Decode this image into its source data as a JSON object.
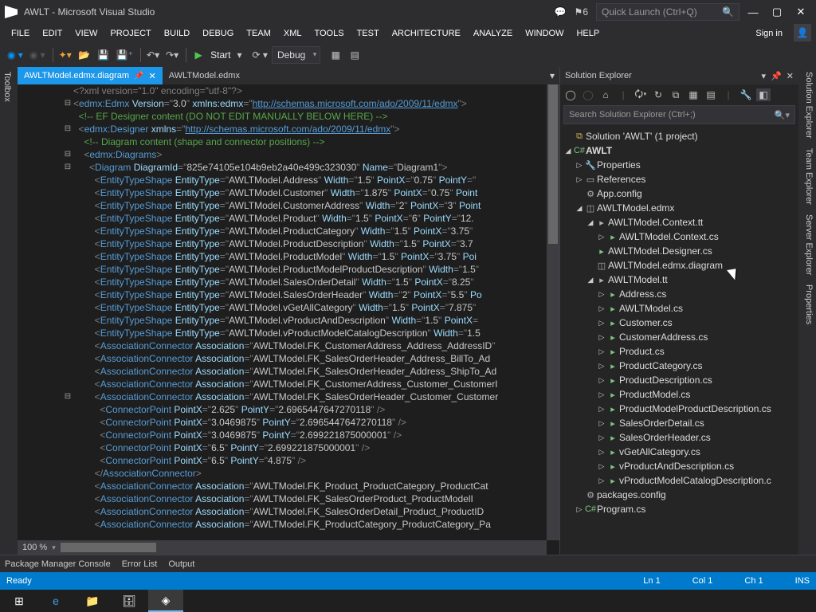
{
  "titlebar": {
    "title": "AWLT - Microsoft Visual Studio",
    "notifications": "6",
    "quicklaunch_placeholder": "Quick Launch (Ctrl+Q)"
  },
  "menu": [
    "FILE",
    "EDIT",
    "VIEW",
    "PROJECT",
    "BUILD",
    "DEBUG",
    "TEAM",
    "XML",
    "TOOLS",
    "TEST",
    "ARCHITECTURE",
    "ANALYZE",
    "WINDOW",
    "HELP"
  ],
  "signin": "Sign in",
  "toolbar": {
    "start": "Start",
    "config": "Debug"
  },
  "left_tool": "Toolbox",
  "tabs": [
    {
      "label": "AWLTModel.edmx.diagram",
      "active": true,
      "pinned": true
    },
    {
      "label": "AWLTModel.edmx",
      "active": false,
      "pinned": false
    }
  ],
  "code_lines": [
    {
      "fold": "",
      "t": "<?xml version=\"1.0\" encoding=\"utf-8\"?>",
      "kind": "pi"
    },
    {
      "fold": "⊟",
      "t": "<edmx:Edmx Version=\"3.0\" xmlns:edmx=\"http://schemas.microsoft.com/ado/2009/11/edmx\">",
      "kind": "el"
    },
    {
      "fold": "",
      "t": "  <!-- EF Designer content (DO NOT EDIT MANUALLY BELOW HERE) -->",
      "kind": "com"
    },
    {
      "fold": "⊟",
      "t": "  <edmx:Designer xmlns=\"http://schemas.microsoft.com/ado/2009/11/edmx\">",
      "kind": "el"
    },
    {
      "fold": "",
      "t": "    <!-- Diagram content (shape and connector positions) -->",
      "kind": "com"
    },
    {
      "fold": "⊟",
      "t": "    <edmx:Diagrams>",
      "kind": "el"
    },
    {
      "fold": "⊟",
      "t": "      <Diagram DiagramId=\"825e74105e104b9eb2a40e499c323030\" Name=\"Diagram1\">",
      "kind": "el"
    },
    {
      "fold": "",
      "t": "        <EntityTypeShape EntityType=\"AWLTModel.Address\" Width=\"1.5\" PointX=\"0.75\" PointY=\"",
      "kind": "el"
    },
    {
      "fold": "",
      "t": "        <EntityTypeShape EntityType=\"AWLTModel.Customer\" Width=\"1.875\" PointX=\"0.75\" Point",
      "kind": "el"
    },
    {
      "fold": "",
      "t": "        <EntityTypeShape EntityType=\"AWLTModel.CustomerAddress\" Width=\"2\" PointX=\"3\" Point",
      "kind": "el"
    },
    {
      "fold": "",
      "t": "        <EntityTypeShape EntityType=\"AWLTModel.Product\" Width=\"1.5\" PointX=\"6\" PointY=\"12.",
      "kind": "el"
    },
    {
      "fold": "",
      "t": "        <EntityTypeShape EntityType=\"AWLTModel.ProductCategory\" Width=\"1.5\" PointX=\"3.75\"",
      "kind": "el"
    },
    {
      "fold": "",
      "t": "        <EntityTypeShape EntityType=\"AWLTModel.ProductDescription\" Width=\"1.5\" PointX=\"3.7",
      "kind": "el"
    },
    {
      "fold": "",
      "t": "        <EntityTypeShape EntityType=\"AWLTModel.ProductModel\" Width=\"1.5\" PointX=\"3.75\" Poi",
      "kind": "el"
    },
    {
      "fold": "",
      "t": "        <EntityTypeShape EntityType=\"AWLTModel.ProductModelProductDescription\" Width=\"1.5\"",
      "kind": "el"
    },
    {
      "fold": "",
      "t": "        <EntityTypeShape EntityType=\"AWLTModel.SalesOrderDetail\" Width=\"1.5\" PointX=\"8.25\"",
      "kind": "el"
    },
    {
      "fold": "",
      "t": "        <EntityTypeShape EntityType=\"AWLTModel.SalesOrderHeader\" Width=\"2\" PointX=\"5.5\" Po",
      "kind": "el"
    },
    {
      "fold": "",
      "t": "        <EntityTypeShape EntityType=\"AWLTModel.vGetAllCategory\" Width=\"1.5\" PointX=\"7.875\"",
      "kind": "el"
    },
    {
      "fold": "",
      "t": "        <EntityTypeShape EntityType=\"AWLTModel.vProductAndDescription\" Width=\"1.5\" PointX=",
      "kind": "el"
    },
    {
      "fold": "",
      "t": "        <EntityTypeShape EntityType=\"AWLTModel.vProductModelCatalogDescription\" Width=\"1.5",
      "kind": "el"
    },
    {
      "fold": "",
      "t": "        <AssociationConnector Association=\"AWLTModel.FK_CustomerAddress_Address_AddressID\"",
      "kind": "el"
    },
    {
      "fold": "",
      "t": "        <AssociationConnector Association=\"AWLTModel.FK_SalesOrderHeader_Address_BillTo_Ad",
      "kind": "el"
    },
    {
      "fold": "",
      "t": "        <AssociationConnector Association=\"AWLTModel.FK_SalesOrderHeader_Address_ShipTo_Ad",
      "kind": "el"
    },
    {
      "fold": "",
      "t": "        <AssociationConnector Association=\"AWLTModel.FK_CustomerAddress_Customer_CustomerI",
      "kind": "el"
    },
    {
      "fold": "⊟",
      "t": "        <AssociationConnector Association=\"AWLTModel.FK_SalesOrderHeader_Customer_Customer",
      "kind": "el"
    },
    {
      "fold": "",
      "t": "          <ConnectorPoint PointX=\"2.625\" PointY=\"2.6965447647270118\" />",
      "kind": "el"
    },
    {
      "fold": "",
      "t": "          <ConnectorPoint PointX=\"3.0469875\" PointY=\"2.6965447647270118\" />",
      "kind": "el"
    },
    {
      "fold": "",
      "t": "          <ConnectorPoint PointX=\"3.0469875\" PointY=\"2.699221875000001\" />",
      "kind": "el"
    },
    {
      "fold": "",
      "t": "          <ConnectorPoint PointX=\"6.5\" PointY=\"2.699221875000001\" />",
      "kind": "el"
    },
    {
      "fold": "",
      "t": "          <ConnectorPoint PointX=\"6.5\" PointY=\"4.875\" />",
      "kind": "el"
    },
    {
      "fold": "",
      "t": "        </AssociationConnector>",
      "kind": "el"
    },
    {
      "fold": "",
      "t": "        <AssociationConnector Association=\"AWLTModel.FK_Product_ProductCategory_ProductCat",
      "kind": "el"
    },
    {
      "fold": "",
      "t": "        <AssociationConnector Association=\"AWLTModel.FK_SalesOrderProduct_ProductModelI",
      "kind": "el"
    },
    {
      "fold": "",
      "t": "        <AssociationConnector Association=\"AWLTModel.FK_SalesOrderDetail_Product_ProductID",
      "kind": "el"
    },
    {
      "fold": "",
      "t": "        <AssociationConnector Association=\"AWLTModel.FK_ProductCategory_ProductCategory_Pa",
      "kind": "el"
    }
  ],
  "zoom": "100 %",
  "solution_explorer": {
    "title": "Solution Explorer",
    "search_placeholder": "Search Solution Explorer (Ctrl+;)",
    "root": "Solution 'AWLT' (1 project)",
    "project": "AWLT",
    "nodes": {
      "properties": "Properties",
      "references": "References",
      "appconfig": "App.config",
      "edmx": "AWLTModel.edmx",
      "contexttt": "AWLTModel.Context.tt",
      "contextcs": "AWLTModel.Context.cs",
      "designercs": "AWLTModel.Designer.cs",
      "diagram": "AWLTModel.edmx.diagram",
      "modeltt": "AWLTModel.tt",
      "files": [
        "Address.cs",
        "AWLTModel.cs",
        "Customer.cs",
        "CustomerAddress.cs",
        "Product.cs",
        "ProductCategory.cs",
        "ProductDescription.cs",
        "ProductModel.cs",
        "ProductModelProductDescription.cs",
        "SalesOrderDetail.cs",
        "SalesOrderHeader.cs",
        "vGetAllCategory.cs",
        "vProductAndDescription.cs",
        "vProductModelCatalogDescription.c"
      ],
      "packages": "packages.config",
      "program": "Program.cs"
    }
  },
  "right_tabs": [
    "Solution Explorer",
    "Team Explorer",
    "Server Explorer",
    "Properties"
  ],
  "bottom_tabs": [
    "Package Manager Console",
    "Error List",
    "Output"
  ],
  "status": {
    "ready": "Ready",
    "ln": "Ln 1",
    "col": "Col 1",
    "ch": "Ch 1",
    "ins": "INS"
  }
}
